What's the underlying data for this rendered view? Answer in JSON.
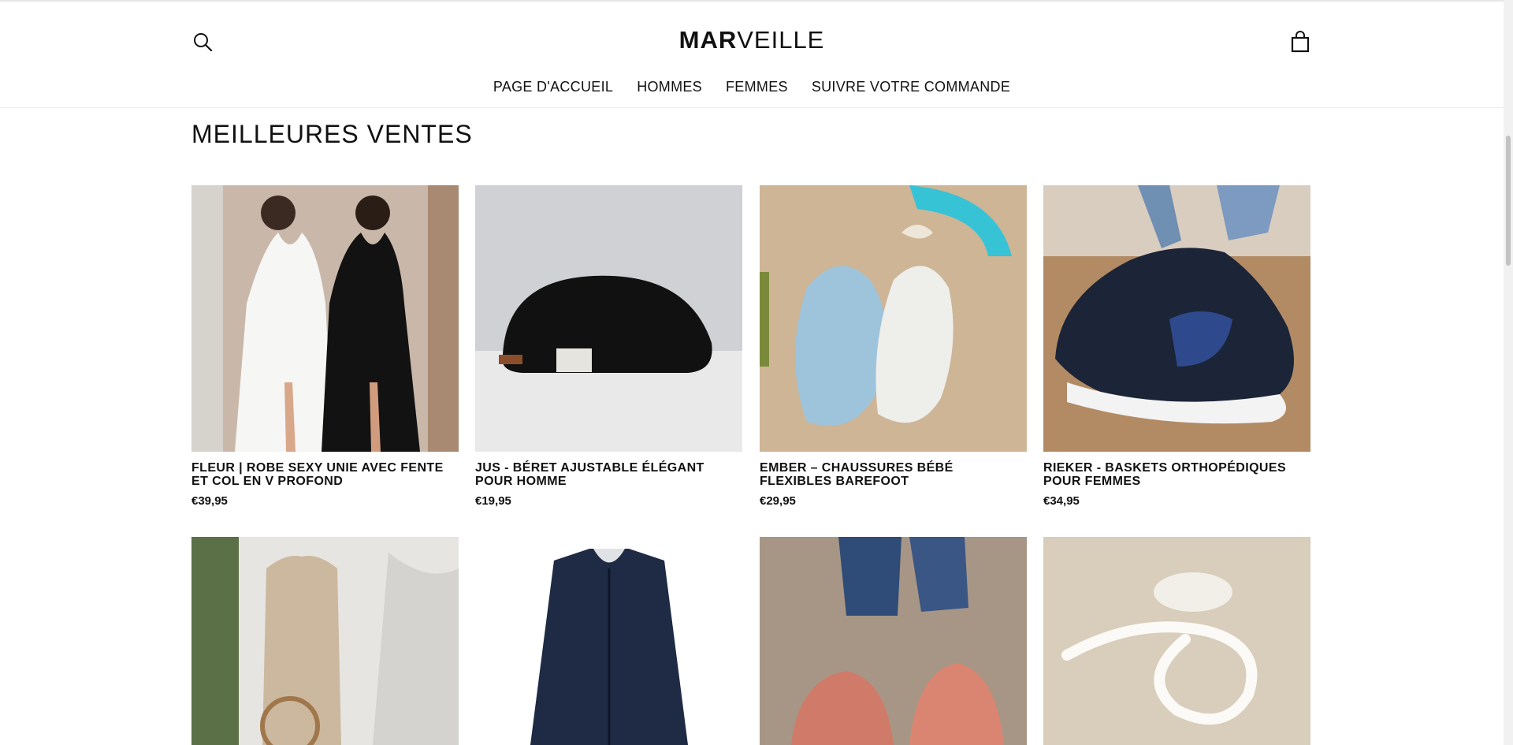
{
  "brand": {
    "logo_bold": "MAR",
    "logo_light": "VEILLE"
  },
  "header": {
    "search_icon": "search-icon",
    "cart_icon": "shopping-bag-icon"
  },
  "nav": {
    "items": [
      "PAGE D'ACCUEIL",
      "HOMMES",
      "FEMMES",
      "SUIVRE VOTRE COMMANDE"
    ]
  },
  "section": {
    "title": "MEILLEURES VENTES"
  },
  "products": [
    {
      "title": "FLEUR | ROBE SEXY UNIE AVEC FENTE ET COL EN V PROFOND",
      "price": "€39,95"
    },
    {
      "title": "JUS - BÉRET AJUSTABLE ÉLÉGANT POUR HOMME",
      "price": "€19,95"
    },
    {
      "title": "EMBER – CHAUSSURES BÉBÉ FLEXIBLES BAREFOOT",
      "price": "€29,95"
    },
    {
      "title": "RIEKER - BASKETS ORTHOPÉDIQUES POUR FEMMES",
      "price": "€34,95"
    }
  ],
  "colors": {
    "text": "#111111",
    "background": "#ffffff",
    "border": "#ededed"
  }
}
